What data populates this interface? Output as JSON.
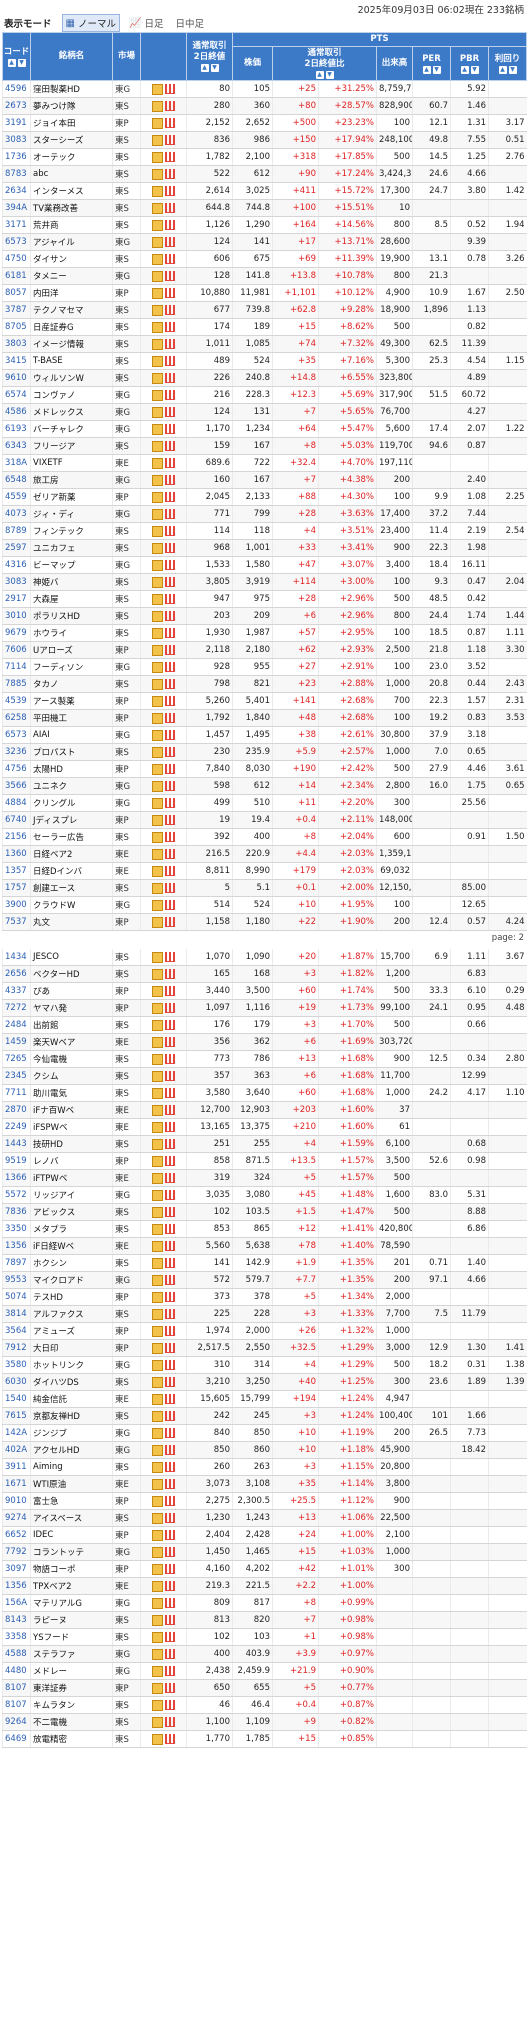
{
  "header": {
    "timestamp": "2025年09月03日 06:02現在 233銘柄"
  },
  "mode": {
    "label": "表示モード",
    "options": [
      "ノーマル",
      "日足",
      "日中足"
    ]
  },
  "columns": {
    "code": "コード",
    "name": "銘柄名",
    "market": "市場",
    "regular_close": "通常取引\n2日終値",
    "pts_group": "PTS",
    "price": "株価",
    "change": "通常取引\n2日終値比",
    "volume": "出来高",
    "per": "PER",
    "pbr": "PBR",
    "yield": "利回り"
  },
  "page2_label": "page: 2",
  "rows_page1": [
    [
      "4596",
      "窪田製薬HD",
      "東G",
      "80",
      "105",
      "+25",
      "+31.25%",
      "8,759,700",
      "",
      "5.92",
      ""
    ],
    [
      "2673",
      "夢みつけ隊",
      "東S",
      "280",
      "360",
      "+80",
      "+28.57%",
      "828,900",
      "60.7",
      "1.46",
      ""
    ],
    [
      "3191",
      "ジョイ本田",
      "東P",
      "2,152",
      "2,652",
      "+500",
      "+23.23%",
      "100",
      "12.1",
      "1.31",
      "3.17"
    ],
    [
      "3083",
      "スターシーズ",
      "東S",
      "836",
      "986",
      "+150",
      "+17.94%",
      "248,100",
      "49.8",
      "7.55",
      "0.51"
    ],
    [
      "1736",
      "オーテック",
      "東S",
      "1,782",
      "2,100",
      "+318",
      "+17.85%",
      "500",
      "14.5",
      "1.25",
      "2.76"
    ],
    [
      "8783",
      "abc",
      "東S",
      "522",
      "612",
      "+90",
      "+17.24%",
      "3,424,300",
      "24.6",
      "4.66",
      ""
    ],
    [
      "2634",
      "インターメス",
      "東S",
      "2,614",
      "3,025",
      "+411",
      "+15.72%",
      "17,300",
      "24.7",
      "3.80",
      "1.42"
    ],
    [
      "394A",
      "TV業務改善",
      "東S",
      "644.8",
      "744.8",
      "+100",
      "+15.51%",
      "10",
      "",
      "",
      ""
    ],
    [
      "3171",
      "荒井商",
      "東S",
      "1,126",
      "1,290",
      "+164",
      "+14.56%",
      "800",
      "8.5",
      "0.52",
      "1.94"
    ],
    [
      "6573",
      "アジャイル",
      "東G",
      "124",
      "141",
      "+17",
      "+13.71%",
      "28,600",
      "",
      "9.39",
      ""
    ],
    [
      "4750",
      "ダイサン",
      "東S",
      "606",
      "675",
      "+69",
      "+11.39%",
      "19,900",
      "13.1",
      "0.78",
      "3.26"
    ],
    [
      "6181",
      "タメニー",
      "東G",
      "128",
      "141.8",
      "+13.8",
      "+10.78%",
      "800",
      "21.3",
      "",
      ""
    ],
    [
      "8057",
      "内田洋",
      "東P",
      "10,880",
      "11,981",
      "+1,101",
      "+10.12%",
      "4,900",
      "10.9",
      "1.67",
      "2.50"
    ],
    [
      "3787",
      "テクノマセマ",
      "東S",
      "677",
      "739.8",
      "+62.8",
      "+9.28%",
      "18,900",
      "1,896",
      "1.13",
      ""
    ],
    [
      "8705",
      "日産証券G",
      "東S",
      "174",
      "189",
      "+15",
      "+8.62%",
      "500",
      "",
      "0.82",
      ""
    ],
    [
      "3803",
      "イメージ情報",
      "東S",
      "1,011",
      "1,085",
      "+74",
      "+7.32%",
      "49,300",
      "62.5",
      "11.39",
      ""
    ],
    [
      "3415",
      "T-BASE",
      "東S",
      "489",
      "524",
      "+35",
      "+7.16%",
      "5,300",
      "25.3",
      "4.54",
      "1.15"
    ],
    [
      "9610",
      "ウィルソンW",
      "東S",
      "226",
      "240.8",
      "+14.8",
      "+6.55%",
      "323,800",
      "",
      "4.89",
      ""
    ],
    [
      "6574",
      "コンヴァノ",
      "東G",
      "216",
      "228.3",
      "+12.3",
      "+5.69%",
      "317,900",
      "51.5",
      "60.72",
      ""
    ],
    [
      "4586",
      "メドレックス",
      "東G",
      "124",
      "131",
      "+7",
      "+5.65%",
      "76,700",
      "",
      "4.27",
      ""
    ],
    [
      "6193",
      "バーチャレク",
      "東G",
      "1,170",
      "1,234",
      "+64",
      "+5.47%",
      "5,600",
      "17.4",
      "2.07",
      "1.22"
    ],
    [
      "6343",
      "フリージア",
      "東S",
      "159",
      "167",
      "+8",
      "+5.03%",
      "119,700",
      "94.6",
      "0.87",
      ""
    ],
    [
      "318A",
      "VIXETF",
      "東E",
      "689.6",
      "722",
      "+32.4",
      "+4.70%",
      "197,110",
      "",
      "",
      ""
    ],
    [
      "6548",
      "旅工房",
      "東G",
      "160",
      "167",
      "+7",
      "+4.38%",
      "200",
      "",
      "2.40",
      ""
    ],
    [
      "4559",
      "ゼリア新薬",
      "東P",
      "2,045",
      "2,133",
      "+88",
      "+4.30%",
      "100",
      "9.9",
      "1.08",
      "2.25"
    ],
    [
      "4073",
      "ジィ・ディ",
      "東G",
      "771",
      "799",
      "+28",
      "+3.63%",
      "17,400",
      "37.2",
      "7.44",
      ""
    ],
    [
      "8789",
      "フィンテック",
      "東S",
      "114",
      "118",
      "+4",
      "+3.51%",
      "23,400",
      "11.4",
      "2.19",
      "2.54"
    ],
    [
      "2597",
      "ユニカフェ",
      "東S",
      "968",
      "1,001",
      "+33",
      "+3.41%",
      "900",
      "22.3",
      "1.98",
      ""
    ],
    [
      "4316",
      "ビーマップ",
      "東G",
      "1,533",
      "1,580",
      "+47",
      "+3.07%",
      "3,400",
      "18.4",
      "16.11",
      ""
    ],
    [
      "3083",
      "神姫バ",
      "東S",
      "3,805",
      "3,919",
      "+114",
      "+3.00%",
      "100",
      "9.3",
      "0.47",
      "2.04"
    ],
    [
      "2917",
      "大森屋",
      "東S",
      "947",
      "975",
      "+28",
      "+2.96%",
      "500",
      "48.5",
      "0.42",
      ""
    ],
    [
      "3010",
      "ポラリスHD",
      "東S",
      "203",
      "209",
      "+6",
      "+2.96%",
      "800",
      "24.4",
      "1.74",
      "1.44"
    ],
    [
      "9679",
      "ホウライ",
      "東S",
      "1,930",
      "1,987",
      "+57",
      "+2.95%",
      "100",
      "18.5",
      "0.87",
      "1.11"
    ],
    [
      "7606",
      "Uアローズ",
      "東P",
      "2,118",
      "2,180",
      "+62",
      "+2.93%",
      "2,500",
      "21.8",
      "1.18",
      "3.30"
    ],
    [
      "7114",
      "フーディソン",
      "東G",
      "928",
      "955",
      "+27",
      "+2.91%",
      "100",
      "23.0",
      "3.52",
      ""
    ],
    [
      "7885",
      "タカノ",
      "東S",
      "798",
      "821",
      "+23",
      "+2.88%",
      "1,000",
      "20.8",
      "0.44",
      "2.43"
    ],
    [
      "4539",
      "アース製薬",
      "東P",
      "5,260",
      "5,401",
      "+141",
      "+2.68%",
      "700",
      "22.3",
      "1.57",
      "2.31"
    ],
    [
      "6258",
      "平田機工",
      "東P",
      "1,792",
      "1,840",
      "+48",
      "+2.68%",
      "100",
      "19.2",
      "0.83",
      "3.53"
    ],
    [
      "6573",
      "AIAI",
      "東G",
      "1,457",
      "1,495",
      "+38",
      "+2.61%",
      "30,800",
      "37.9",
      "3.18",
      ""
    ],
    [
      "3236",
      "プロパスト",
      "東S",
      "230",
      "235.9",
      "+5.9",
      "+2.57%",
      "1,000",
      "7.0",
      "0.65",
      ""
    ],
    [
      "4756",
      "太陽HD",
      "東P",
      "7,840",
      "8,030",
      "+190",
      "+2.42%",
      "500",
      "27.9",
      "4.46",
      "3.61"
    ],
    [
      "3566",
      "ユニネク",
      "東G",
      "598",
      "612",
      "+14",
      "+2.34%",
      "2,800",
      "16.0",
      "1.75",
      "0.65"
    ],
    [
      "4884",
      "クリングル",
      "東G",
      "499",
      "510",
      "+11",
      "+2.20%",
      "300",
      "",
      "25.56",
      ""
    ],
    [
      "6740",
      "Jディスプレ",
      "東P",
      "19",
      "19.4",
      "+0.4",
      "+2.11%",
      "148,000",
      "",
      "",
      ""
    ],
    [
      "2156",
      "セーラー広告",
      "東S",
      "392",
      "400",
      "+8",
      "+2.04%",
      "600",
      "",
      "0.91",
      "1.50"
    ],
    [
      "1360",
      "日経ベア2",
      "東E",
      "216.5",
      "220.9",
      "+4.4",
      "+2.03%",
      "1,359,150",
      "",
      "",
      ""
    ],
    [
      "1357",
      "日経Dインバ",
      "東E",
      "8,811",
      "8,990",
      "+179",
      "+2.03%",
      "69,032",
      "",
      "",
      ""
    ],
    [
      "1757",
      "創建エース",
      "東S",
      "5",
      "5.1",
      "+0.1",
      "+2.00%",
      "12,150,900",
      "",
      "85.00",
      ""
    ],
    [
      "3900",
      "クラウドW",
      "東G",
      "514",
      "524",
      "+10",
      "+1.95%",
      "100",
      "",
      "12.65",
      ""
    ],
    [
      "7537",
      "丸文",
      "東P",
      "1,158",
      "1,180",
      "+22",
      "+1.90%",
      "200",
      "12.4",
      "0.57",
      "4.24"
    ]
  ],
  "rows_page2": [
    [
      "1434",
      "JESCO",
      "東S",
      "1,070",
      "1,090",
      "+20",
      "+1.87%",
      "15,700",
      "6.9",
      "1.11",
      "3.67"
    ],
    [
      "2656",
      "ベクターHD",
      "東S",
      "165",
      "168",
      "+3",
      "+1.82%",
      "1,200",
      "",
      "6.83",
      ""
    ],
    [
      "4337",
      "ぴあ",
      "東P",
      "3,440",
      "3,500",
      "+60",
      "+1.74%",
      "500",
      "33.3",
      "6.10",
      "0.29"
    ],
    [
      "7272",
      "ヤマハ発",
      "東P",
      "1,097",
      "1,116",
      "+19",
      "+1.73%",
      "99,100",
      "24.1",
      "0.95",
      "4.48"
    ],
    [
      "2484",
      "出前館",
      "東S",
      "176",
      "179",
      "+3",
      "+1.70%",
      "500",
      "",
      "0.66",
      ""
    ],
    [
      "1459",
      "楽天Wベア",
      "東E",
      "356",
      "362",
      "+6",
      "+1.69%",
      "303,720",
      "",
      "",
      ""
    ],
    [
      "7265",
      "今仙電機",
      "東S",
      "773",
      "786",
      "+13",
      "+1.68%",
      "900",
      "12.5",
      "0.34",
      "2.80"
    ],
    [
      "2345",
      "クシム",
      "東S",
      "357",
      "363",
      "+6",
      "+1.68%",
      "11,700",
      "",
      "12.99",
      ""
    ],
    [
      "7711",
      "助川電気",
      "東S",
      "3,580",
      "3,640",
      "+60",
      "+1.68%",
      "1,000",
      "24.2",
      "4.17",
      "1.10"
    ],
    [
      "2870",
      "iFナ百Wベ",
      "東E",
      "12,700",
      "12,903",
      "+203",
      "+1.60%",
      "37",
      "",
      "",
      ""
    ],
    [
      "2249",
      "iFSPWベ",
      "東E",
      "13,165",
      "13,375",
      "+210",
      "+1.60%",
      "61",
      "",
      "",
      ""
    ],
    [
      "1443",
      "技研HD",
      "東S",
      "251",
      "255",
      "+4",
      "+1.59%",
      "6,100",
      "",
      "0.68",
      ""
    ],
    [
      "9519",
      "レノバ",
      "東P",
      "858",
      "871.5",
      "+13.5",
      "+1.57%",
      "3,500",
      "52.6",
      "0.98",
      ""
    ],
    [
      "1366",
      "iFTPWベ",
      "東E",
      "319",
      "324",
      "+5",
      "+1.57%",
      "500",
      "",
      "",
      ""
    ],
    [
      "5572",
      "リッジアイ",
      "東G",
      "3,035",
      "3,080",
      "+45",
      "+1.48%",
      "1,600",
      "83.0",
      "5.31",
      ""
    ],
    [
      "7836",
      "アビックス",
      "東S",
      "102",
      "103.5",
      "+1.5",
      "+1.47%",
      "500",
      "",
      "8.88",
      ""
    ],
    [
      "3350",
      "メタプラ",
      "東S",
      "853",
      "865",
      "+12",
      "+1.41%",
      "420,800",
      "",
      "6.86",
      ""
    ],
    [
      "1356",
      "iF日経Wベ",
      "東E",
      "5,560",
      "5,638",
      "+78",
      "+1.40%",
      "78,590",
      "",
      "",
      ""
    ],
    [
      "7897",
      "ホクシン",
      "東S",
      "141",
      "142.9",
      "+1.9",
      "+1.35%",
      "201",
      "0.71",
      "1.40",
      ""
    ],
    [
      "9553",
      "マイクロアド",
      "東G",
      "572",
      "579.7",
      "+7.7",
      "+1.35%",
      "200",
      "97.1",
      "4.66",
      ""
    ],
    [
      "5074",
      "テスHD",
      "東P",
      "373",
      "378",
      "+5",
      "+1.34%",
      "2,000",
      "",
      "",
      ""
    ],
    [
      "3814",
      "アルファクス",
      "東S",
      "225",
      "228",
      "+3",
      "+1.33%",
      "7,700",
      "7.5",
      "11.79",
      ""
    ],
    [
      "3564",
      "アミューズ",
      "東P",
      "1,974",
      "2,000",
      "+26",
      "+1.32%",
      "1,000",
      "",
      "",
      ""
    ],
    [
      "7912",
      "大日印",
      "東P",
      "2,517.5",
      "2,550",
      "+32.5",
      "+1.29%",
      "3,000",
      "12.9",
      "1.30",
      "1.41"
    ],
    [
      "3580",
      "ホットリンク",
      "東G",
      "310",
      "314",
      "+4",
      "+1.29%",
      "500",
      "18.2",
      "0.31",
      "1.38"
    ],
    [
      "6030",
      "ダイハツDS",
      "東S",
      "3,210",
      "3,250",
      "+40",
      "+1.25%",
      "300",
      "23.6",
      "1.89",
      "1.39"
    ],
    [
      "1540",
      "純金信託",
      "東E",
      "15,605",
      "15,799",
      "+194",
      "+1.24%",
      "4,947",
      "",
      "",
      ""
    ],
    [
      "7615",
      "京都友禅HD",
      "東S",
      "242",
      "245",
      "+3",
      "+1.24%",
      "100,400",
      "101",
      "1.66",
      ""
    ],
    [
      "142A",
      "ジンジブ",
      "東G",
      "840",
      "850",
      "+10",
      "+1.19%",
      "200",
      "26.5",
      "7.73",
      ""
    ],
    [
      "402A",
      "アクセルHD",
      "東G",
      "850",
      "860",
      "+10",
      "+1.18%",
      "45,900",
      "",
      "18.42",
      ""
    ],
    [
      "3911",
      "Aiming",
      "東S",
      "260",
      "263",
      "+3",
      "+1.15%",
      "20,800",
      "",
      "",
      ""
    ],
    [
      "1671",
      "WTI原油",
      "東E",
      "3,073",
      "3,108",
      "+35",
      "+1.14%",
      "3,800",
      "",
      "",
      ""
    ],
    [
      "9010",
      "富士急",
      "東P",
      "2,275",
      "2,300.5",
      "+25.5",
      "+1.12%",
      "900",
      "",
      "",
      ""
    ],
    [
      "9274",
      "アイスベース",
      "東S",
      "1,230",
      "1,243",
      "+13",
      "+1.06%",
      "22,500",
      "",
      "",
      ""
    ],
    [
      "6652",
      "IDEC",
      "東P",
      "2,404",
      "2,428",
      "+24",
      "+1.00%",
      "2,100",
      "",
      "",
      ""
    ],
    [
      "7792",
      "コラントッテ",
      "東G",
      "1,450",
      "1,465",
      "+15",
      "+1.03%",
      "1,000",
      "",
      "",
      ""
    ],
    [
      "3097",
      "物語コーポ",
      "東P",
      "4,160",
      "4,202",
      "+42",
      "+1.01%",
      "300",
      "",
      "",
      ""
    ],
    [
      "1356",
      "TPXベア2",
      "東E",
      "219.3",
      "221.5",
      "+2.2",
      "+1.00%",
      "",
      "",
      "",
      ""
    ],
    [
      "156A",
      "マテリアルG",
      "東G",
      "809",
      "817",
      "+8",
      "+0.99%",
      "",
      "",
      "",
      ""
    ],
    [
      "8143",
      "ラピーヌ",
      "東S",
      "813",
      "820",
      "+7",
      "+0.98%",
      "",
      "",
      "",
      ""
    ],
    [
      "3358",
      "YSフード",
      "東S",
      "102",
      "103",
      "+1",
      "+0.98%",
      "",
      "",
      "",
      ""
    ],
    [
      "4588",
      "ステラファ",
      "東G",
      "400",
      "403.9",
      "+3.9",
      "+0.97%",
      "",
      "",
      "",
      ""
    ],
    [
      "4480",
      "メドレー",
      "東G",
      "2,438",
      "2,459.9",
      "+21.9",
      "+0.90%",
      "",
      "",
      "",
      ""
    ],
    [
      "8107",
      "東洋証券",
      "東P",
      "650",
      "655",
      "+5",
      "+0.77%",
      "",
      "",
      "",
      ""
    ],
    [
      "8107",
      "キムラタン",
      "東S",
      "46",
      "46.4",
      "+0.4",
      "+0.87%",
      "",
      "",
      "",
      ""
    ],
    [
      "9264",
      "不二電機",
      "東S",
      "1,100",
      "1,109",
      "+9",
      "+0.82%",
      "",
      "",
      "",
      ""
    ],
    [
      "6469",
      "放電精密",
      "東S",
      "1,770",
      "1,785",
      "+15",
      "+0.85%",
      "",
      "",
      "",
      ""
    ]
  ]
}
